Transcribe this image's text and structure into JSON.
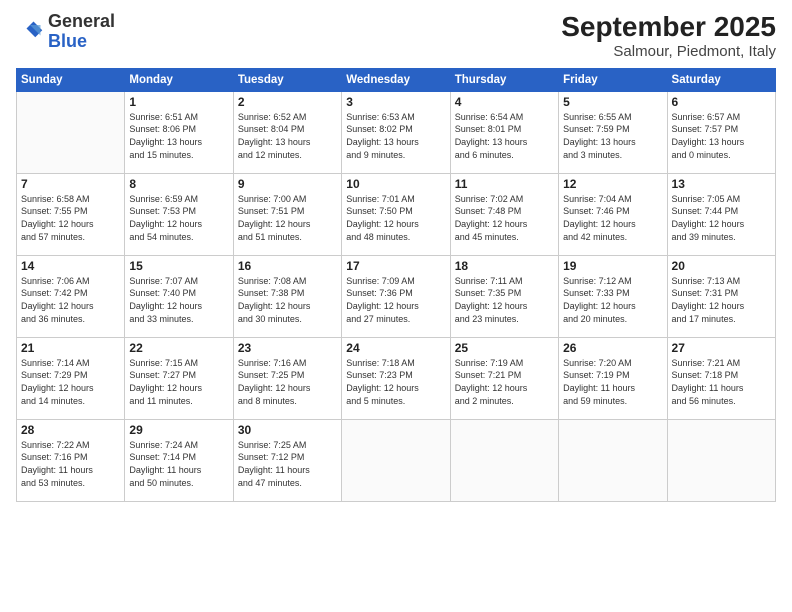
{
  "header": {
    "logo_general": "General",
    "logo_blue": "Blue",
    "month_title": "September 2025",
    "subtitle": "Salmour, Piedmont, Italy"
  },
  "weekdays": [
    "Sunday",
    "Monday",
    "Tuesday",
    "Wednesday",
    "Thursday",
    "Friday",
    "Saturday"
  ],
  "weeks": [
    [
      {
        "day": "",
        "info": ""
      },
      {
        "day": "1",
        "info": "Sunrise: 6:51 AM\nSunset: 8:06 PM\nDaylight: 13 hours\nand 15 minutes."
      },
      {
        "day": "2",
        "info": "Sunrise: 6:52 AM\nSunset: 8:04 PM\nDaylight: 13 hours\nand 12 minutes."
      },
      {
        "day": "3",
        "info": "Sunrise: 6:53 AM\nSunset: 8:02 PM\nDaylight: 13 hours\nand 9 minutes."
      },
      {
        "day": "4",
        "info": "Sunrise: 6:54 AM\nSunset: 8:01 PM\nDaylight: 13 hours\nand 6 minutes."
      },
      {
        "day": "5",
        "info": "Sunrise: 6:55 AM\nSunset: 7:59 PM\nDaylight: 13 hours\nand 3 minutes."
      },
      {
        "day": "6",
        "info": "Sunrise: 6:57 AM\nSunset: 7:57 PM\nDaylight: 13 hours\nand 0 minutes."
      }
    ],
    [
      {
        "day": "7",
        "info": "Sunrise: 6:58 AM\nSunset: 7:55 PM\nDaylight: 12 hours\nand 57 minutes."
      },
      {
        "day": "8",
        "info": "Sunrise: 6:59 AM\nSunset: 7:53 PM\nDaylight: 12 hours\nand 54 minutes."
      },
      {
        "day": "9",
        "info": "Sunrise: 7:00 AM\nSunset: 7:51 PM\nDaylight: 12 hours\nand 51 minutes."
      },
      {
        "day": "10",
        "info": "Sunrise: 7:01 AM\nSunset: 7:50 PM\nDaylight: 12 hours\nand 48 minutes."
      },
      {
        "day": "11",
        "info": "Sunrise: 7:02 AM\nSunset: 7:48 PM\nDaylight: 12 hours\nand 45 minutes."
      },
      {
        "day": "12",
        "info": "Sunrise: 7:04 AM\nSunset: 7:46 PM\nDaylight: 12 hours\nand 42 minutes."
      },
      {
        "day": "13",
        "info": "Sunrise: 7:05 AM\nSunset: 7:44 PM\nDaylight: 12 hours\nand 39 minutes."
      }
    ],
    [
      {
        "day": "14",
        "info": "Sunrise: 7:06 AM\nSunset: 7:42 PM\nDaylight: 12 hours\nand 36 minutes."
      },
      {
        "day": "15",
        "info": "Sunrise: 7:07 AM\nSunset: 7:40 PM\nDaylight: 12 hours\nand 33 minutes."
      },
      {
        "day": "16",
        "info": "Sunrise: 7:08 AM\nSunset: 7:38 PM\nDaylight: 12 hours\nand 30 minutes."
      },
      {
        "day": "17",
        "info": "Sunrise: 7:09 AM\nSunset: 7:36 PM\nDaylight: 12 hours\nand 27 minutes."
      },
      {
        "day": "18",
        "info": "Sunrise: 7:11 AM\nSunset: 7:35 PM\nDaylight: 12 hours\nand 23 minutes."
      },
      {
        "day": "19",
        "info": "Sunrise: 7:12 AM\nSunset: 7:33 PM\nDaylight: 12 hours\nand 20 minutes."
      },
      {
        "day": "20",
        "info": "Sunrise: 7:13 AM\nSunset: 7:31 PM\nDaylight: 12 hours\nand 17 minutes."
      }
    ],
    [
      {
        "day": "21",
        "info": "Sunrise: 7:14 AM\nSunset: 7:29 PM\nDaylight: 12 hours\nand 14 minutes."
      },
      {
        "day": "22",
        "info": "Sunrise: 7:15 AM\nSunset: 7:27 PM\nDaylight: 12 hours\nand 11 minutes."
      },
      {
        "day": "23",
        "info": "Sunrise: 7:16 AM\nSunset: 7:25 PM\nDaylight: 12 hours\nand 8 minutes."
      },
      {
        "day": "24",
        "info": "Sunrise: 7:18 AM\nSunset: 7:23 PM\nDaylight: 12 hours\nand 5 minutes."
      },
      {
        "day": "25",
        "info": "Sunrise: 7:19 AM\nSunset: 7:21 PM\nDaylight: 12 hours\nand 2 minutes."
      },
      {
        "day": "26",
        "info": "Sunrise: 7:20 AM\nSunset: 7:19 PM\nDaylight: 11 hours\nand 59 minutes."
      },
      {
        "day": "27",
        "info": "Sunrise: 7:21 AM\nSunset: 7:18 PM\nDaylight: 11 hours\nand 56 minutes."
      }
    ],
    [
      {
        "day": "28",
        "info": "Sunrise: 7:22 AM\nSunset: 7:16 PM\nDaylight: 11 hours\nand 53 minutes."
      },
      {
        "day": "29",
        "info": "Sunrise: 7:24 AM\nSunset: 7:14 PM\nDaylight: 11 hours\nand 50 minutes."
      },
      {
        "day": "30",
        "info": "Sunrise: 7:25 AM\nSunset: 7:12 PM\nDaylight: 11 hours\nand 47 minutes."
      },
      {
        "day": "",
        "info": ""
      },
      {
        "day": "",
        "info": ""
      },
      {
        "day": "",
        "info": ""
      },
      {
        "day": "",
        "info": ""
      }
    ]
  ]
}
